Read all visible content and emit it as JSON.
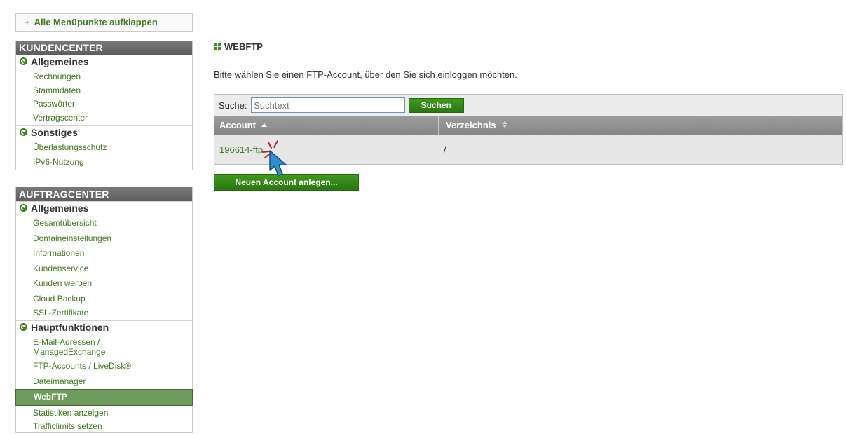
{
  "expand_all": {
    "icon": "+",
    "label": "Alle Menüpunkte aufklappen"
  },
  "kundencenter": {
    "title": "KUNDENCENTER",
    "groups": [
      {
        "title": "Allgemeines",
        "items": [
          "Rechnungen",
          "Stammdaten",
          "Passwörter",
          "Vertragscenter"
        ]
      },
      {
        "title": "Sonstiges",
        "items": [
          "Überlastungsschutz",
          "IPv6-Nutzung"
        ]
      }
    ]
  },
  "auftragcenter": {
    "title": "AUFTRAGCENTER",
    "groups": [
      {
        "title": "Allgemeines",
        "items": [
          "Gesamtübersicht",
          "Domaineinstellungen",
          "Informationen",
          "Kundenservice",
          "Kunden werben",
          "Cloud Backup",
          "SSL-Zertifikate"
        ]
      },
      {
        "title": "Hauptfunktionen",
        "items": [
          "E-Mail-Adressen / ManagedExchange",
          "FTP-Accounts / LiveDisk®",
          "Dateimanager",
          "WebFTP",
          "Statistiken anzeigen",
          "Trafficlimits setzen"
        ]
      }
    ]
  },
  "main": {
    "title": "WEBFTP",
    "intro": "Bitte wählen Sie einen FTP-Account, über den Sie sich einloggen möchten.",
    "search": {
      "label": "Suche:",
      "placeholder": "Suchtext",
      "button": "Suchen"
    },
    "columns": [
      "Account",
      "Verzeichnis"
    ],
    "rows": [
      {
        "account": "196614-ftp",
        "directory": "/"
      }
    ],
    "new_account_button": "Neuen Account anlegen..."
  },
  "colors": {
    "link_green": "#3e7a1e",
    "button_green": "#2f8a14",
    "header_gray": "#6a6a6a",
    "active_item": "#6e9b5c"
  },
  "icons": {
    "expand": "plus-icon",
    "group": "chevron-circle-down-icon",
    "title": "grid-icon",
    "sort_asc": "sort-up-icon",
    "sort_both": "sort-icon",
    "cursor": "hand-cursor-icon"
  }
}
